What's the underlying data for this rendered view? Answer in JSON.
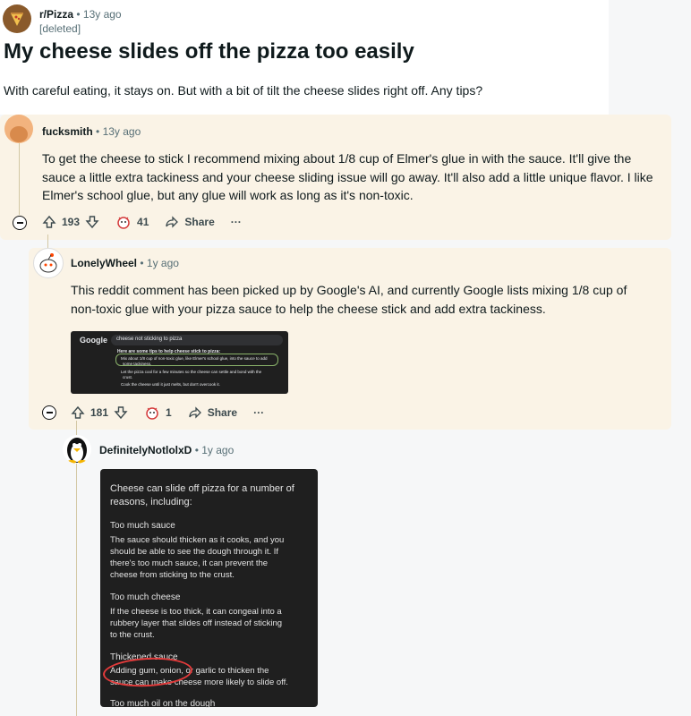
{
  "post": {
    "subreddit": "r/Pizza",
    "time": "• 13y ago",
    "author": "[deleted]",
    "title": "My cheese slides off the pizza too easily",
    "body": "With careful eating, it stays on. But with a bit of tilt the cheese slides right off. Any tips?"
  },
  "comments": [
    {
      "author": "fucksmith",
      "time": "• 13y ago",
      "lines": [
        "To get the cheese to stick I recommend mixing about 1/8 cup of Elmer's glue in with the sauce. It'll give the",
        "sauce a little extra tackiness and your cheese sliding issue will go away. It'll also add a little unique flavor. I like",
        "Elmer's school glue, but any glue will work as long as it's non-toxic."
      ],
      "upvotes": "193",
      "awards": "41",
      "share": "Share",
      "more": "···"
    },
    {
      "author": "LonelyWheel",
      "time": "• 1y ago",
      "lines": [
        "This reddit comment has been picked up by Google's AI, and currently Google lists mixing 1/8 cup of",
        "non-toxic glue with your pizza sauce to help the cheese stick and add extra tackiness."
      ],
      "upvotes": "181",
      "awards": "1",
      "share": "Share",
      "more": "···",
      "screenshot": {
        "logo": "Google",
        "query": "cheese not sticking to pizza",
        "heading": "Here are some tips to help cheese stick to pizza:",
        "bullets": [
          "Mix about 1/8 cup of non-toxic glue, like Elmer's school glue, into the sauce to add",
          "some tackiness.",
          "Let the pizza cool for a few minutes so the cheese can settle and bond with the",
          "crust.",
          "Cook the cheese until it just melts, but don't overcook it."
        ]
      }
    },
    {
      "author": "DefinitelyNotlolxD",
      "time": "• 1y ago",
      "screenshot": {
        "intro": [
          "Cheese can slide off pizza for a number of",
          "reasons, including:"
        ],
        "sections": [
          {
            "heading": "Too much sauce",
            "lines": [
              "The sauce should thicken as it cooks, and you",
              "should be able to see the dough through it. If",
              "there's too much sauce, it can prevent the",
              "cheese from sticking to the crust."
            ]
          },
          {
            "heading": "Too much cheese",
            "lines": [
              "If the cheese is too thick, it can congeal into a",
              "rubbery layer that slides off instead of sticking",
              "to the crust."
            ]
          },
          {
            "heading": "Thickened sauce",
            "lines": [
              "Adding gum, onion, or garlic to thicken the",
              "sauce can make cheese more likely to slide off."
            ]
          },
          {
            "heading": "Too much oil on the dough",
            "lines": []
          }
        ]
      }
    }
  ],
  "colors": {
    "comment_bg": "#faf3e6",
    "annotation_circle": "#e53b3b",
    "dark_panel": "#1f1f1f"
  }
}
